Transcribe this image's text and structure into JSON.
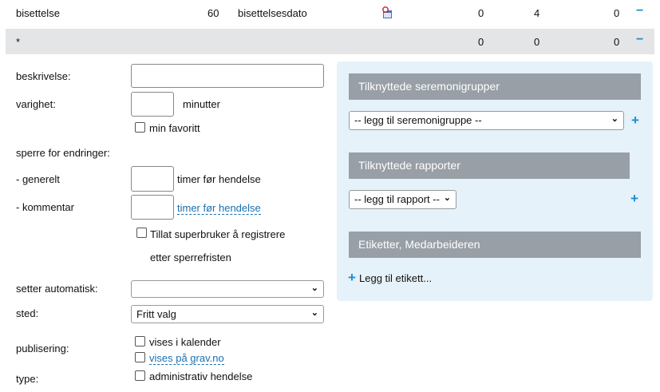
{
  "rows": [
    {
      "name": "bisettelse",
      "duration": "60",
      "field": "bisettelsesdato",
      "icon": "calendar-clock-icon",
      "c1": "0",
      "c2": "4",
      "c3": "0",
      "action": "−"
    },
    {
      "name": "*",
      "c1": "0",
      "c2": "0",
      "c3": "0",
      "action": "−"
    }
  ],
  "form": {
    "beskrivelse_label": "beskrivelse:",
    "beskrivelse_value": "",
    "varighet_label": "varighet:",
    "varighet_value": "",
    "minutter": "minutter",
    "favoritt": "min favoritt",
    "sperre_label": "sperre for endringer:",
    "generelt_label": "- generelt",
    "generelt_suffix": "timer før hendelse",
    "kommentar_label": "- kommentar",
    "kommentar_suffix": "timer før hendelse",
    "superbruker_1": "Tillat superbruker å registrere",
    "superbruker_2": "etter sperrefristen",
    "setter_label": "setter automatisk:",
    "setter_value": "",
    "sted_label": "sted:",
    "sted_value": "Fritt valg",
    "publisering_label": "publisering:",
    "kalender": "vises i kalender",
    "grav": "vises på grav.no",
    "type_label": "type:",
    "administrativ": "administrativ hendelse"
  },
  "panel": {
    "seremoni_header": "Tilknyttede seremonigrupper",
    "seremoni_select": "-- legg til seremonigruppe --",
    "rapport_header": "Tilknyttede rapporter",
    "rapport_select": "-- legg til rapport --",
    "etikett_header": "Etiketter, Medarbeideren",
    "etikett_add": "Legg til etikett...",
    "plus": "+"
  },
  "colors": {
    "accent": "#1a8fcf",
    "header_bg": "#989fa6",
    "panel_bg": "#e6f2f9",
    "row_alt": "#e4e5e7"
  }
}
